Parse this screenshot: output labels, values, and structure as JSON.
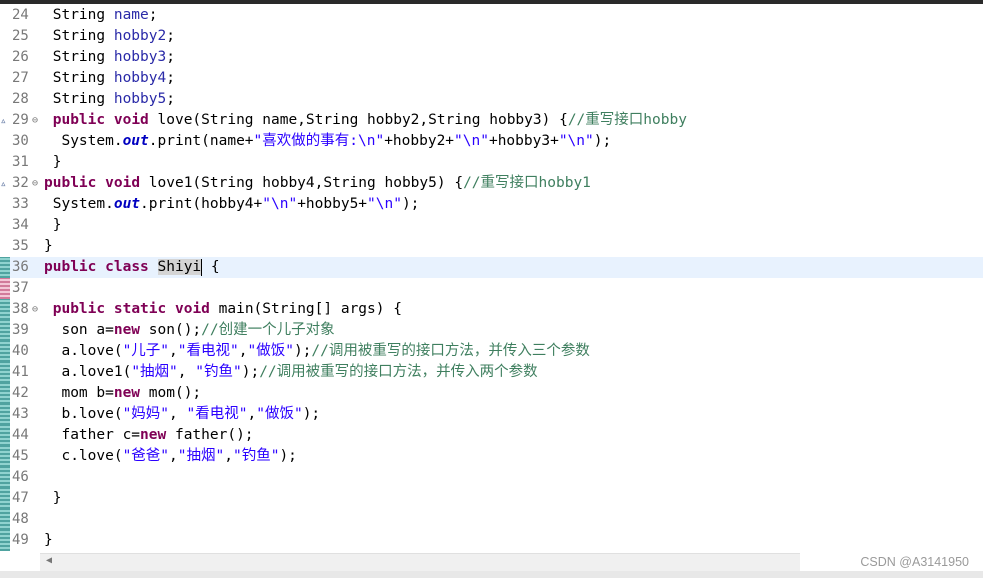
{
  "editor": {
    "lines": [
      {
        "n": "24",
        "tokens": [
          {
            "t": " String ",
            "c": ""
          },
          {
            "t": "name",
            "c": "var"
          },
          {
            "t": ";",
            "c": ""
          }
        ]
      },
      {
        "n": "25",
        "tokens": [
          {
            "t": " String ",
            "c": ""
          },
          {
            "t": "hobby2",
            "c": "var"
          },
          {
            "t": ";",
            "c": ""
          }
        ]
      },
      {
        "n": "26",
        "tokens": [
          {
            "t": " String ",
            "c": ""
          },
          {
            "t": "hobby3",
            "c": "var"
          },
          {
            "t": ";",
            "c": ""
          }
        ]
      },
      {
        "n": "27",
        "tokens": [
          {
            "t": " String ",
            "c": ""
          },
          {
            "t": "hobby4",
            "c": "var"
          },
          {
            "t": ";",
            "c": ""
          }
        ]
      },
      {
        "n": "28",
        "tokens": [
          {
            "t": " String ",
            "c": ""
          },
          {
            "t": "hobby5",
            "c": "var"
          },
          {
            "t": ";",
            "c": ""
          }
        ]
      },
      {
        "n": "29",
        "arrow": true,
        "fold": true,
        "tokens": [
          {
            "t": " ",
            "c": ""
          },
          {
            "t": "public",
            "c": "kw"
          },
          {
            "t": " ",
            "c": ""
          },
          {
            "t": "void",
            "c": "kw"
          },
          {
            "t": " love(String name,String hobby2,String hobby3) {",
            "c": ""
          },
          {
            "t": "//重写接口hobby",
            "c": "cmt"
          }
        ]
      },
      {
        "n": "30",
        "tokens": [
          {
            "t": "  System.",
            "c": ""
          },
          {
            "t": "out",
            "c": "fld"
          },
          {
            "t": ".print(name+",
            "c": ""
          },
          {
            "t": "\"喜欢做的事有:\\n\"",
            "c": "str"
          },
          {
            "t": "+hobby2+",
            "c": ""
          },
          {
            "t": "\"\\n\"",
            "c": "str"
          },
          {
            "t": "+hobby3+",
            "c": ""
          },
          {
            "t": "\"\\n\"",
            "c": "str"
          },
          {
            "t": ");",
            "c": ""
          }
        ]
      },
      {
        "n": "31",
        "tokens": [
          {
            "t": " }",
            "c": ""
          }
        ]
      },
      {
        "n": "32",
        "arrow": true,
        "fold": true,
        "tokens": [
          {
            "t": "public",
            "c": "kw"
          },
          {
            "t": " ",
            "c": ""
          },
          {
            "t": "void",
            "c": "kw"
          },
          {
            "t": " love1(String hobby4,String hobby5) {",
            "c": ""
          },
          {
            "t": "//重写接口hobby1",
            "c": "cmt"
          }
        ]
      },
      {
        "n": "33",
        "tokens": [
          {
            "t": " System.",
            "c": ""
          },
          {
            "t": "out",
            "c": "fld"
          },
          {
            "t": ".print(hobby4+",
            "c": ""
          },
          {
            "t": "\"\\n\"",
            "c": "str"
          },
          {
            "t": "+hobby5+",
            "c": ""
          },
          {
            "t": "\"\\n\"",
            "c": "str"
          },
          {
            "t": ");",
            "c": ""
          }
        ]
      },
      {
        "n": "34",
        "tokens": [
          {
            "t": " }",
            "c": ""
          }
        ]
      },
      {
        "n": "35",
        "tokens": [
          {
            "t": "}",
            "c": ""
          }
        ]
      },
      {
        "n": "36",
        "current": true,
        "mark": "diff",
        "tokens": [
          {
            "t": "public",
            "c": "kw"
          },
          {
            "t": " ",
            "c": ""
          },
          {
            "t": "class",
            "c": "kw"
          },
          {
            "t": " ",
            "c": ""
          },
          {
            "t": "Shiyi",
            "c": "sel"
          },
          {
            "t": "|",
            "c": "caret"
          },
          {
            "t": " {",
            "c": ""
          }
        ]
      },
      {
        "n": "37",
        "mark": "added",
        "tokens": []
      },
      {
        "n": "38",
        "fold": true,
        "mark": "diff",
        "tokens": [
          {
            "t": " ",
            "c": ""
          },
          {
            "t": "public",
            "c": "kw"
          },
          {
            "t": " ",
            "c": ""
          },
          {
            "t": "static",
            "c": "kw"
          },
          {
            "t": " ",
            "c": ""
          },
          {
            "t": "void",
            "c": "kw"
          },
          {
            "t": " main(String[] args) {",
            "c": ""
          }
        ]
      },
      {
        "n": "39",
        "mark": "diff",
        "tokens": [
          {
            "t": "  son a=",
            "c": ""
          },
          {
            "t": "new",
            "c": "kw"
          },
          {
            "t": " son();",
            "c": ""
          },
          {
            "t": "//创建一个儿子对象",
            "c": "cmt"
          }
        ]
      },
      {
        "n": "40",
        "mark": "diff",
        "tokens": [
          {
            "t": "  a.love(",
            "c": ""
          },
          {
            "t": "\"儿子\"",
            "c": "str"
          },
          {
            "t": ",",
            "c": ""
          },
          {
            "t": "\"看电视\"",
            "c": "str"
          },
          {
            "t": ",",
            "c": ""
          },
          {
            "t": "\"做饭\"",
            "c": "str"
          },
          {
            "t": ");",
            "c": ""
          },
          {
            "t": "//调用被重写的接口方法，并传入三个参数",
            "c": "cmt"
          }
        ]
      },
      {
        "n": "41",
        "mark": "diff",
        "tokens": [
          {
            "t": "  a.love1(",
            "c": ""
          },
          {
            "t": "\"抽烟\"",
            "c": "str"
          },
          {
            "t": ", ",
            "c": ""
          },
          {
            "t": "\"钓鱼\"",
            "c": "str"
          },
          {
            "t": ");",
            "c": ""
          },
          {
            "t": "//调用被重写的接口方法，并传入两个参数",
            "c": "cmt"
          }
        ]
      },
      {
        "n": "42",
        "mark": "diff",
        "tokens": [
          {
            "t": "  mom b=",
            "c": ""
          },
          {
            "t": "new",
            "c": "kw"
          },
          {
            "t": " mom();",
            "c": ""
          }
        ]
      },
      {
        "n": "43",
        "mark": "diff",
        "tokens": [
          {
            "t": "  b.love(",
            "c": ""
          },
          {
            "t": "\"妈妈\"",
            "c": "str"
          },
          {
            "t": ", ",
            "c": ""
          },
          {
            "t": "\"看电视\"",
            "c": "str"
          },
          {
            "t": ",",
            "c": ""
          },
          {
            "t": "\"做饭\"",
            "c": "str"
          },
          {
            "t": ");",
            "c": ""
          }
        ]
      },
      {
        "n": "44",
        "mark": "diff",
        "tokens": [
          {
            "t": "  father c=",
            "c": ""
          },
          {
            "t": "new",
            "c": "kw"
          },
          {
            "t": " father();",
            "c": ""
          }
        ]
      },
      {
        "n": "45",
        "mark": "diff",
        "tokens": [
          {
            "t": "  c.love(",
            "c": ""
          },
          {
            "t": "\"爸爸\"",
            "c": "str"
          },
          {
            "t": ",",
            "c": ""
          },
          {
            "t": "\"抽烟\"",
            "c": "str"
          },
          {
            "t": ",",
            "c": ""
          },
          {
            "t": "\"钓鱼\"",
            "c": "str"
          },
          {
            "t": ");",
            "c": ""
          }
        ]
      },
      {
        "n": "46",
        "mark": "diff",
        "tokens": []
      },
      {
        "n": "47",
        "mark": "diff",
        "tokens": [
          {
            "t": " }",
            "c": ""
          }
        ]
      },
      {
        "n": "48",
        "mark": "diff",
        "tokens": []
      },
      {
        "n": "49",
        "mark": "diff",
        "tokens": [
          {
            "t": "}",
            "c": ""
          }
        ]
      }
    ]
  },
  "scrollbar": {
    "left_icon": "scroll-left-arrow-icon"
  },
  "watermark": "CSDN @A3141950",
  "colors": {
    "keyword": "#7f0055",
    "variable": "#2a2aa8",
    "string": "#2a00ff",
    "comment": "#3f7f5f",
    "current_line": "#e8f2fe",
    "line_number": "#787878"
  }
}
